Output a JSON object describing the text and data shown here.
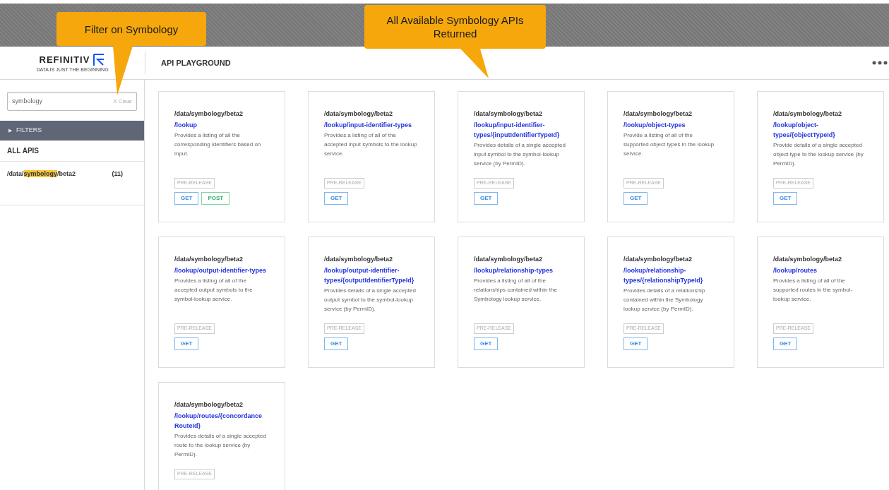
{
  "callouts": [
    {
      "text": "Filter on Symbology"
    },
    {
      "text": "All Available Symbology APIs Returned"
    }
  ],
  "logo": {
    "name": "REFINITIV",
    "tagline": "DATA IS JUST THE BEGINNING"
  },
  "header": {
    "title": "API PLAYGROUND"
  },
  "sidebar": {
    "search": {
      "value": "symbology",
      "clear": "X Clear"
    },
    "filters": {
      "icon": "▶",
      "label": "FILTERS",
      "expanded": false
    },
    "section": "ALL APIS",
    "items": [
      {
        "path_before": "/data/",
        "match": "symbology",
        "path_after": "/beta2",
        "count": "(11)"
      }
    ]
  },
  "cards": [
    {
      "base": "/data/symbology/beta2",
      "path": "/lookup",
      "description": "Provides a listing of all the corresponding identifiers based on input.",
      "tag": "PRE-RELEASE",
      "methods": [
        {
          "kind": "get",
          "label": "GET"
        },
        {
          "kind": "post",
          "label": "POST"
        }
      ]
    },
    {
      "base": "/data/symbology/beta2",
      "path": "/lookup/input-identifier-types",
      "description": "Provides a listing of all of the accepted input symbols to the lookup service.",
      "tag": "PRE-RELEASE",
      "methods": [
        {
          "kind": "get",
          "label": "GET"
        }
      ]
    },
    {
      "base": "/data/symbology/beta2",
      "path": "/lookup/input-identifier-types/{inputIdentifierTypeId}",
      "description": "Provides details of a single accepted input symbol to the symbol-lookup service (by PermID).",
      "tag": "PRE-RELEASE",
      "methods": [
        {
          "kind": "get",
          "label": "GET"
        }
      ]
    },
    {
      "base": "/data/symbology/beta2",
      "path": "/lookup/object-types",
      "description": "Provide a listing of all of the supported object types in the lookup service.",
      "tag": "PRE-RELEASE",
      "methods": [
        {
          "kind": "get",
          "label": "GET"
        }
      ]
    },
    {
      "base": "/data/symbology/beta2",
      "path": "/lookup/object-types/{objectTypeId}",
      "description": "Provide details of a single accepted object type to the lookup service (by PermID).",
      "tag": "PRE-RELEASE",
      "methods": [
        {
          "kind": "get",
          "label": "GET"
        }
      ]
    },
    {
      "base": "/data/symbology/beta2",
      "path": "/lookup/output-identifier-types",
      "description": "Provides a listing of all of the accepted output symbols to the symbol-lookup service.",
      "tag": "PRE-RELEASE",
      "methods": [
        {
          "kind": "get",
          "label": "GET"
        }
      ]
    },
    {
      "base": "/data/symbology/beta2",
      "path": "/lookup/output-identifier-types/{outputIdentifierTypeId}",
      "description": "Provides details of a single accepted output symbol to the symbol-lookup service (by PermID).",
      "tag": "PRE-RELEASE",
      "methods": [
        {
          "kind": "get",
          "label": "GET"
        }
      ]
    },
    {
      "base": "/data/symbology/beta2",
      "path": "/lookup/relationship-types",
      "description": "Provides a listing of all of the relationships contained within the Symbology lookup service.",
      "tag": "PRE-RELEASE",
      "methods": [
        {
          "kind": "get",
          "label": "GET"
        }
      ]
    },
    {
      "base": "/data/symbology/beta2",
      "path": "/lookup/relationship-types/{relationshipTypeId}",
      "description": "Provides details of a relationship contained within the Symbology lookup service (by PermID).",
      "tag": "PRE-RELEASE",
      "methods": [
        {
          "kind": "get",
          "label": "GET"
        }
      ]
    },
    {
      "base": "/data/symbology/beta2",
      "path": "/lookup/routes",
      "description": "Provides a listing of all of the supported routes in the symbol-lookup service.",
      "tag": "PRE-RELEASE",
      "methods": [
        {
          "kind": "get",
          "label": "GET"
        }
      ]
    },
    {
      "base": "/data/symbology/beta2",
      "path": "/lookup/routes/{concordance RouteId}",
      "description": "Provides details of a single accepted route to the lookup service (by PermID).",
      "tag": "PRE-RELEASE"
    }
  ]
}
